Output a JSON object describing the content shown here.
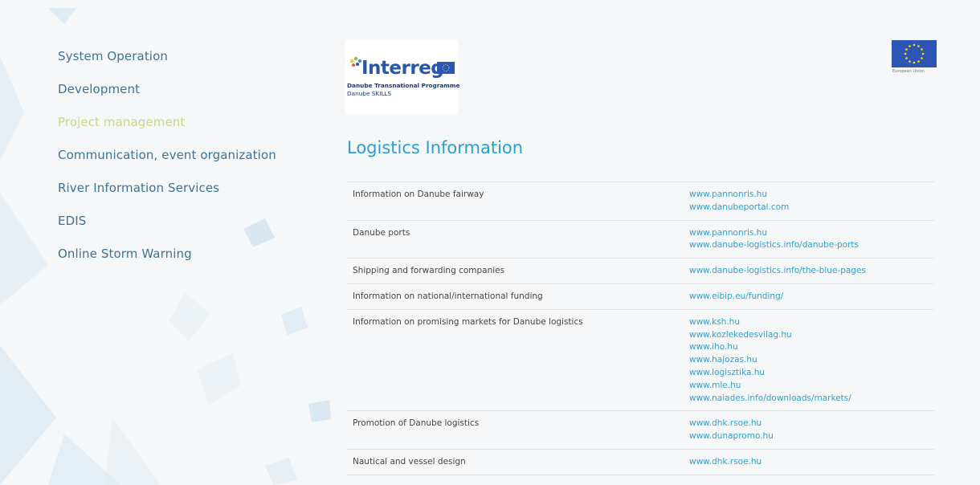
{
  "nav": {
    "items": [
      {
        "label": "System Operation"
      },
      {
        "label": "Development"
      },
      {
        "label": "Project management",
        "active": true
      },
      {
        "label": "Communication, event organization"
      },
      {
        "label": "River Information Services"
      },
      {
        "label": "EDIS"
      },
      {
        "label": "Online Storm Warning"
      }
    ]
  },
  "logo": {
    "brand": "Interreg",
    "line1": "Danube Transnational Programme",
    "line2": "Danube SKILLS"
  },
  "eu_flag": {
    "caption": "European Union"
  },
  "main": {
    "title": "Logistics Information",
    "rows": [
      {
        "topic": "Information on Danube fairway",
        "links": [
          "www.pannonris.hu",
          "www.danubeportal.com"
        ]
      },
      {
        "topic": "Danube ports",
        "links": [
          "www.pannonris.hu",
          "www.danube-logistics.info/danube-ports"
        ]
      },
      {
        "topic": "Shipping and forwarding companies",
        "links": [
          "www.danube-logistics.info/the-blue-pages"
        ]
      },
      {
        "topic": "Information on national/international funding",
        "links": [
          "www.eibip.eu/funding/"
        ]
      },
      {
        "topic": "Information on promising markets for Danube logistics",
        "links": [
          "www.ksh.hu",
          "www.kozlekedesvilag.hu",
          "www.iho.hu",
          "www.hajozas.hu",
          "www.logisztika.hu",
          "www.mle.hu",
          "www.naiades.info/downloads/markets/"
        ]
      },
      {
        "topic": "Promotion of Danube logistics",
        "links": [
          "www.dhk.rsoe.hu",
          "www.dunapromo.hu"
        ]
      },
      {
        "topic": "Nautical and vessel design",
        "links": [
          "www.dhk.rsoe.hu"
        ]
      }
    ]
  },
  "colors": {
    "background": "#f6f7f8",
    "nav_text": "#3d7396",
    "nav_active": "#c6d788",
    "heading": "#2a9fd0",
    "link": "#2f9fd3",
    "body_text": "#454545",
    "row_rule": "#e1e4e7",
    "eu_blue": "#2d55b4",
    "eu_star": "#ffdd00"
  }
}
